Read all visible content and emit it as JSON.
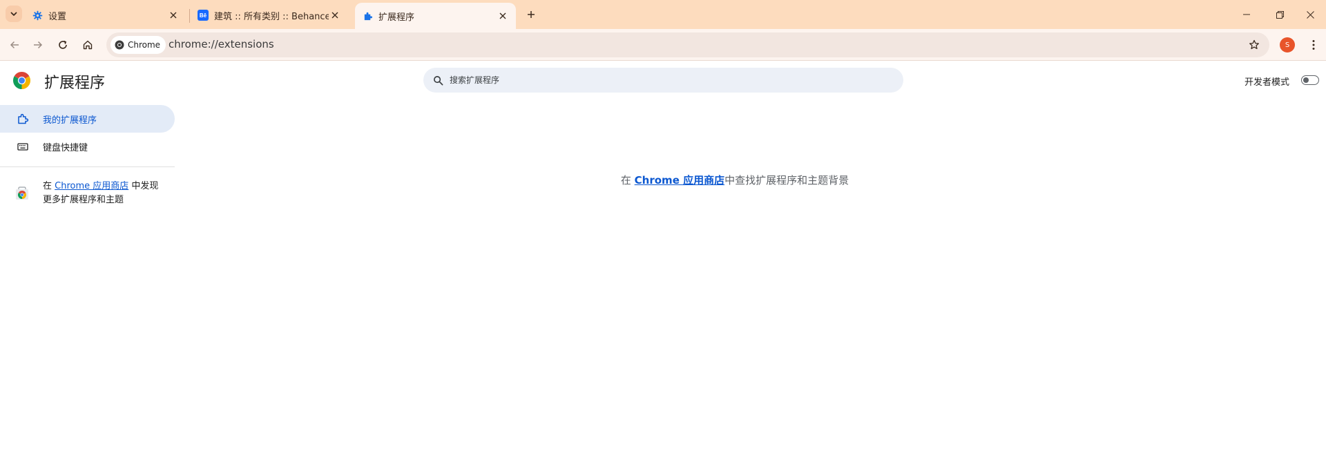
{
  "tabs": [
    {
      "title": "设置",
      "icon": "gear-icon",
      "active": false
    },
    {
      "title": "建筑 :: 所有类别 :: Behance",
      "icon": "behance-icon",
      "icon_text": "Bē",
      "active": false
    },
    {
      "title": "扩展程序",
      "icon": "puzzle-icon",
      "active": true
    }
  ],
  "toolbar": {
    "site_chip_label": "Chrome",
    "url": "chrome://extensions",
    "profile_initial": "S"
  },
  "page": {
    "title": "扩展程序",
    "search_placeholder": "搜索扩展程序",
    "dev_mode_label": "开发者模式",
    "dev_mode_on": false
  },
  "sidebar": {
    "items": [
      {
        "label": "我的扩展程序",
        "icon": "extensions-icon",
        "active": true
      },
      {
        "label": "键盘快捷键",
        "icon": "keyboard-icon",
        "active": false
      }
    ],
    "promo": {
      "prefix": "在 ",
      "link": "Chrome 应用商店",
      "suffix": " 中发现更多扩展程序和主题"
    }
  },
  "main": {
    "prefix": "在 ",
    "link": "Chrome 应用商店",
    "suffix": "中查找扩展程序和主题背景"
  },
  "colors": {
    "tabstrip": "#fddcbe",
    "toolbar": "#fdf4ef",
    "accent": "#0b57d0",
    "avatar": "#e8542a"
  }
}
